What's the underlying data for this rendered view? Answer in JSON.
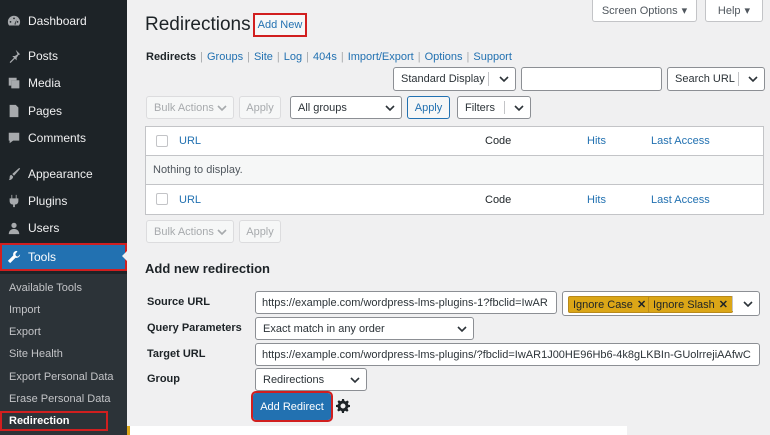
{
  "sidebar": {
    "items": [
      {
        "label": "Dashboard",
        "icon": "dashboard-icon"
      },
      {
        "label": "Posts",
        "icon": "pin-icon"
      },
      {
        "label": "Media",
        "icon": "media-icon"
      },
      {
        "label": "Pages",
        "icon": "pages-icon"
      },
      {
        "label": "Comments",
        "icon": "comment-icon"
      },
      {
        "label": "Appearance",
        "icon": "brush-icon"
      },
      {
        "label": "Plugins",
        "icon": "plugin-icon"
      },
      {
        "label": "Users",
        "icon": "users-icon"
      },
      {
        "label": "Tools",
        "icon": "wrench-icon"
      }
    ],
    "submenu": [
      "Available Tools",
      "Import",
      "Export",
      "Site Health",
      "Export Personal Data",
      "Erase Personal Data",
      "Redirection"
    ]
  },
  "header": {
    "screen_options": "Screen Options",
    "help": "Help",
    "title": "Redirections",
    "add_new": "Add New"
  },
  "views": [
    {
      "label": "Redirects",
      "current": true
    },
    {
      "label": "Groups"
    },
    {
      "label": "Site"
    },
    {
      "label": "Log"
    },
    {
      "label": "404s"
    },
    {
      "label": "Import/Export"
    },
    {
      "label": "Options"
    },
    {
      "label": "Support"
    }
  ],
  "search": {
    "display_select": "Standard Display",
    "search_value": "",
    "search_button": "Search URL"
  },
  "toolbar": {
    "bulk_actions": "Bulk Actions",
    "apply": "Apply",
    "group_filter": "All groups",
    "apply2": "Apply",
    "filters": "Filters"
  },
  "table": {
    "columns": {
      "url": "URL",
      "code": "Code",
      "hits": "Hits",
      "last_access": "Last Access"
    },
    "empty": "Nothing to display."
  },
  "bottom_toolbar": {
    "bulk_actions": "Bulk Actions",
    "apply": "Apply"
  },
  "form": {
    "title": "Add new redirection",
    "source_label": "Source URL",
    "source_value": "https://example.com/wordpress-lms-plugins-1?fbclid=IwAR",
    "flags": [
      "Ignore Case",
      "Ignore Slash"
    ],
    "query_label": "Query Parameters",
    "query_value": "Exact match in any order",
    "target_label": "Target URL",
    "target_value": "https://example.com/wordpress-lms-plugins/?fbclid=IwAR1J00HE96Hb6-4k8gLKBIn-GUolrrejiAAfwC",
    "group_label": "Group",
    "group_value": "Redirections",
    "submit": "Add Redirect"
  },
  "colors": {
    "accent": "#2271b1",
    "highlight": "#d11f1f",
    "tag": "#dba617",
    "sidebar": "#1d2327"
  }
}
